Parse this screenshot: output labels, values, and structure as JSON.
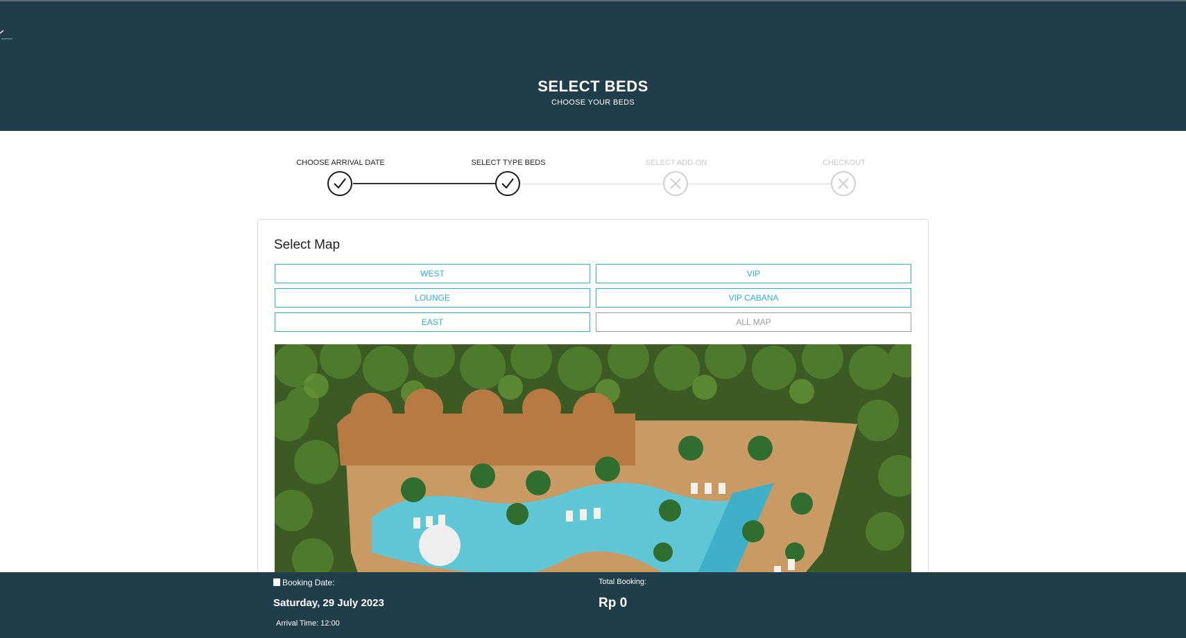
{
  "header": {
    "title": "SELECT BEDS",
    "subtitle": "CHOOSE YOUR BEDS"
  },
  "steps": [
    {
      "label": "CHOOSE ARRIVAL DATE",
      "status": "done"
    },
    {
      "label": "SELECT TYPE BEDS",
      "status": "done"
    },
    {
      "label": "SELECT ADD-ON",
      "status": "pending"
    },
    {
      "label": "CHECKOUT",
      "status": "pending"
    }
  ],
  "select_map": {
    "title": "Select Map",
    "buttons": [
      {
        "label": "WEST",
        "active": true
      },
      {
        "label": "VIP",
        "active": true
      },
      {
        "label": "LOUNGE",
        "active": true
      },
      {
        "label": "VIP CABANA",
        "active": true
      },
      {
        "label": "EAST",
        "active": true
      },
      {
        "label": "ALL MAP",
        "active": false
      }
    ]
  },
  "footer": {
    "booking_date_label": "Booking Date:",
    "booking_date": "Saturday, 29 July 2023",
    "arrival_time": "Arrival Time: 12:00",
    "total_label": "Total Booking:",
    "total_value": "Rp 0"
  },
  "colors": {
    "header_bg": "#203d4a",
    "accent": "#29b3cc",
    "inactive": "#9a9a9a"
  }
}
